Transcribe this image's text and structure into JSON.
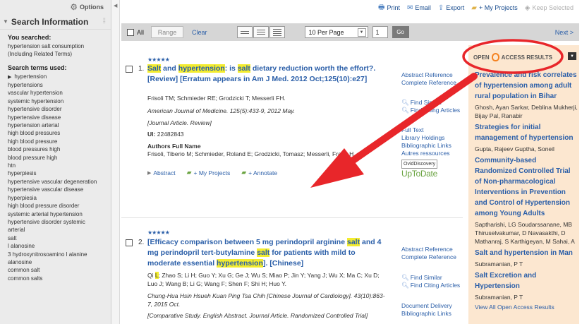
{
  "sidebar": {
    "options_label": "Options",
    "title": "Search Information",
    "searched_heading": "You searched:",
    "searched_text": [
      "hypertension salt consumption",
      "(Including Related Terms)"
    ],
    "terms_heading": "Search terms used:",
    "first_term": "hypertension",
    "terms": [
      "hypertensions",
      "vascular hypertension",
      "systemic hypertension",
      "hypertensive disorder",
      "hypertensive disease",
      "hypertension arterial",
      "high blood pressures",
      "high blood pressure",
      "blood pressures high",
      "blood pressure high",
      "htn",
      "hyperpiesis",
      "hypertensive vascular degeneration",
      "hypertensive vascular disease",
      "hyperpiesia",
      "high blood pressure disorder",
      "systemic arterial hypertension",
      "hypertensive disorder systemic",
      "arterial",
      "salt",
      "l alanosine",
      "3 hydroxynitrosoamino l alanine",
      "alanosine",
      "common salt",
      "common salts"
    ]
  },
  "topbar": {
    "print": "Print",
    "email": "Email",
    "export": "Export",
    "my_projects": "+ My Projects",
    "keep_selected": "Keep Selected"
  },
  "toolbar": {
    "all_label": "All",
    "range_label": "Range",
    "clear_label": "Clear",
    "per_page": "10 Per Page",
    "page_number": "1",
    "go_label": "Go",
    "next_label": "Next >"
  },
  "results": [
    {
      "number": "1.",
      "stars": "★★★★★",
      "title_parts": [
        "Salt",
        " and ",
        "hypertension",
        ": is ",
        "salt",
        " dietary reduction worth the effort?. [Review] [Erratum appears in Am J Med. 2012 Oct;125(10):e27]"
      ],
      "authors": "Frisoli TM; Schmieder RE; Grodzicki T; Messerli FH.",
      "journal": "American Journal of Medicine. 125(5):433-9, 2012 May.",
      "type": "[Journal Article. Review]",
      "ui_label": "UI:",
      "ui_value": "22482843",
      "full_name_label": "Authors Full Name",
      "full_name": "Frisoli, Tiberio M; Schmieder, Roland E; Grodzicki, Tomasz; Messerli, Franz H.",
      "links": [
        "Abstract",
        "+ My Projects",
        "+ Annotate"
      ],
      "right_links": [
        "Abstract Reference",
        "Complete Reference",
        "Find Similar",
        "Find Citing Articles",
        "Full Text",
        "Library Holdings",
        "Bibliographic Links",
        "Autres ressources"
      ],
      "ovid": "OvidDiscovery",
      "uptodate": "UpToDate"
    },
    {
      "number": "2.",
      "stars": "★★★★★",
      "title_parts": [
        "[Efficacy comparison between 5 mg perindopril arginine ",
        "salt",
        " and 4 mg perindopril tert-butylamine ",
        "salt",
        " for patients with mild to moderate essential ",
        "hypertension",
        "]. [Chinese]"
      ],
      "authors_parts": [
        "Qi ",
        "L",
        "; Zhao S; Li H; Guo Y; Xu G; Ge J; Wu S; Miao P; Jin Y; Yang J; Wu X; Ma C; Xu D; Luo J; Wang B; Li G; Wang F; Shen F; Shi H; Huo Y."
      ],
      "journal": "Chung-Hua Hsin Hsueh Kuan Ping Tsa Chih [Chinese Journal of Cardiology]. 43(10):863-7, 2015 Oct.",
      "type": "[Comparative Study. English Abstract. Journal Article. Randomized Controlled Trial]",
      "right_links": [
        "Abstract Reference",
        "Complete Reference",
        "Find Similar",
        "Find Citing Articles",
        "Document Delivery",
        "Bibliographic Links"
      ]
    }
  ],
  "open_access": {
    "open_word": "OPEN",
    "results_word": "ACCESS RESULTS",
    "items": [
      {
        "title": "Prevalence and risk correlates of hypertension among adult rural population in Bihar",
        "authors": "Ghosh, Ayan Sarkar, Deblina Mukherji, Bijay Pal, Ranabir"
      },
      {
        "title": "Strategies for initial management of hypertension",
        "authors": "Gupta, Rajeev Guptha, Soneil"
      },
      {
        "title": "Community-based Randomized Controlled Trial of Non-pharmacological Interventions in Prevention and Control of Hypertension among Young Adults",
        "authors": "Saptharishi, LG Soudarssanane, MB Thiruselvakumar, D Navasakthi, D Mathanraj, S Karthigeyan, M Sahai, A"
      },
      {
        "title": "Salt and hypertension in Man",
        "authors": "Subramanian, P T"
      },
      {
        "title": "Salt Excretion and Hypertension",
        "authors": "Subramanian, P T"
      }
    ],
    "view_all": "View All Open Access Results"
  },
  "colors": {
    "link": "#2a5ea8",
    "highlight": "#f3ec2f",
    "annotation": "#e8262a",
    "oa_panel": "#fce7d0",
    "oa_orange": "#f58220"
  }
}
